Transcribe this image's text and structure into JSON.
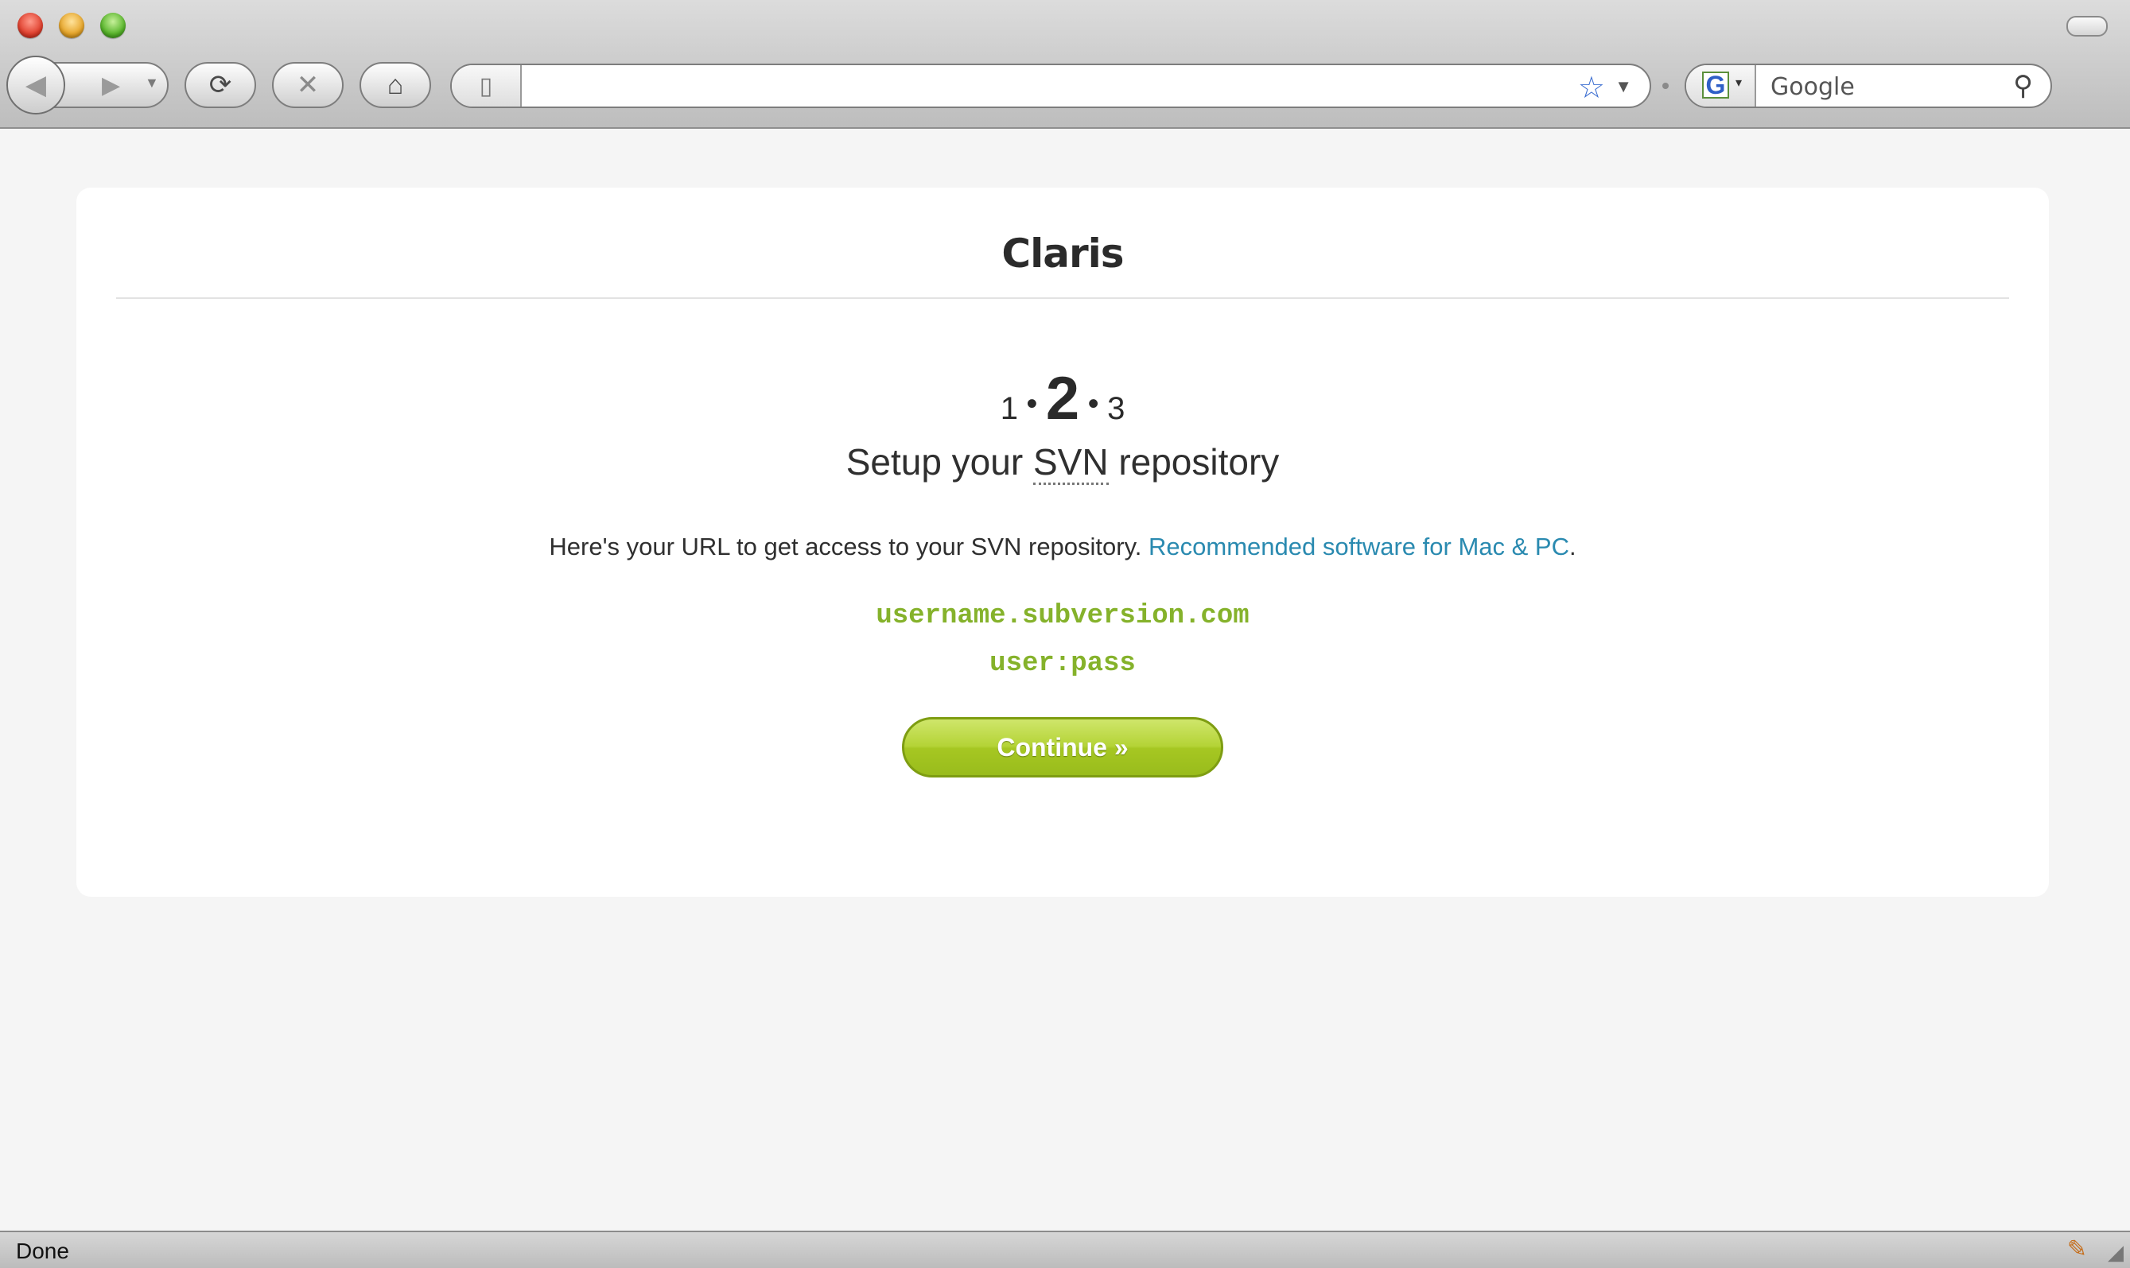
{
  "browser": {
    "url_value": "",
    "search_engine_label": "G",
    "search_placeholder": "Google",
    "status_text": "Done"
  },
  "page": {
    "site_title": "Claris",
    "steps": {
      "step1": "1",
      "step2": "2",
      "step3": "3",
      "separator": "•"
    },
    "heading_prefix": "Setup your ",
    "heading_abbr": "SVN",
    "heading_suffix": " repository",
    "description": "Here's your URL to get access to your SVN repository. ",
    "link_text": "Recommended software for Mac & PC",
    "link_trailing": ".",
    "repo_url": "username.subversion.com",
    "credentials": "user:pass",
    "continue_label": "Continue »"
  },
  "colors": {
    "accent_green": "#85b22b",
    "link_blue": "#2a8ab0",
    "button_green": "#a6c722"
  },
  "icons": [
    "back-icon",
    "forward-icon",
    "reload-icon",
    "stop-icon",
    "home-icon",
    "page-icon",
    "bookmark-star-icon",
    "search-icon",
    "addon-icon"
  ]
}
